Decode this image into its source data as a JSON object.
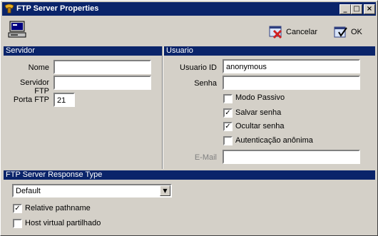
{
  "window": {
    "title": "FTP Server Properties"
  },
  "title_buttons": {
    "minimize": "_",
    "maximize": "□",
    "close": "×"
  },
  "actions": {
    "cancel_label": "Cancelar",
    "ok_label": "OK"
  },
  "servidor": {
    "header": "Servidor",
    "nome_label": "Nome",
    "nome_value": "",
    "servidor_ftp_label": "Servidor FTP",
    "servidor_ftp_value": "",
    "porta_label": "Porta FTP",
    "porta_value": "21"
  },
  "usuario": {
    "header": "Usuario",
    "id_label": "Usuario ID",
    "id_value": "anonymous",
    "senha_label": "Senha",
    "senha_value": "",
    "options": [
      {
        "label": "Modo Passivo",
        "checked": false
      },
      {
        "label": "Salvar senha",
        "checked": true
      },
      {
        "label": "Ocultar senha",
        "checked": true
      },
      {
        "label": "Autenticação anônima",
        "checked": false
      }
    ],
    "email_label": "E-Mail",
    "email_value": ""
  },
  "response": {
    "header": "FTP Server Response Type",
    "selected": "Default",
    "options": [
      {
        "label": "Relative pathname",
        "checked": true
      },
      {
        "label": "Host virtual partilhado",
        "checked": false
      }
    ]
  },
  "colors": {
    "titlebar": "#0a246a",
    "face": "#d4d0c8"
  }
}
